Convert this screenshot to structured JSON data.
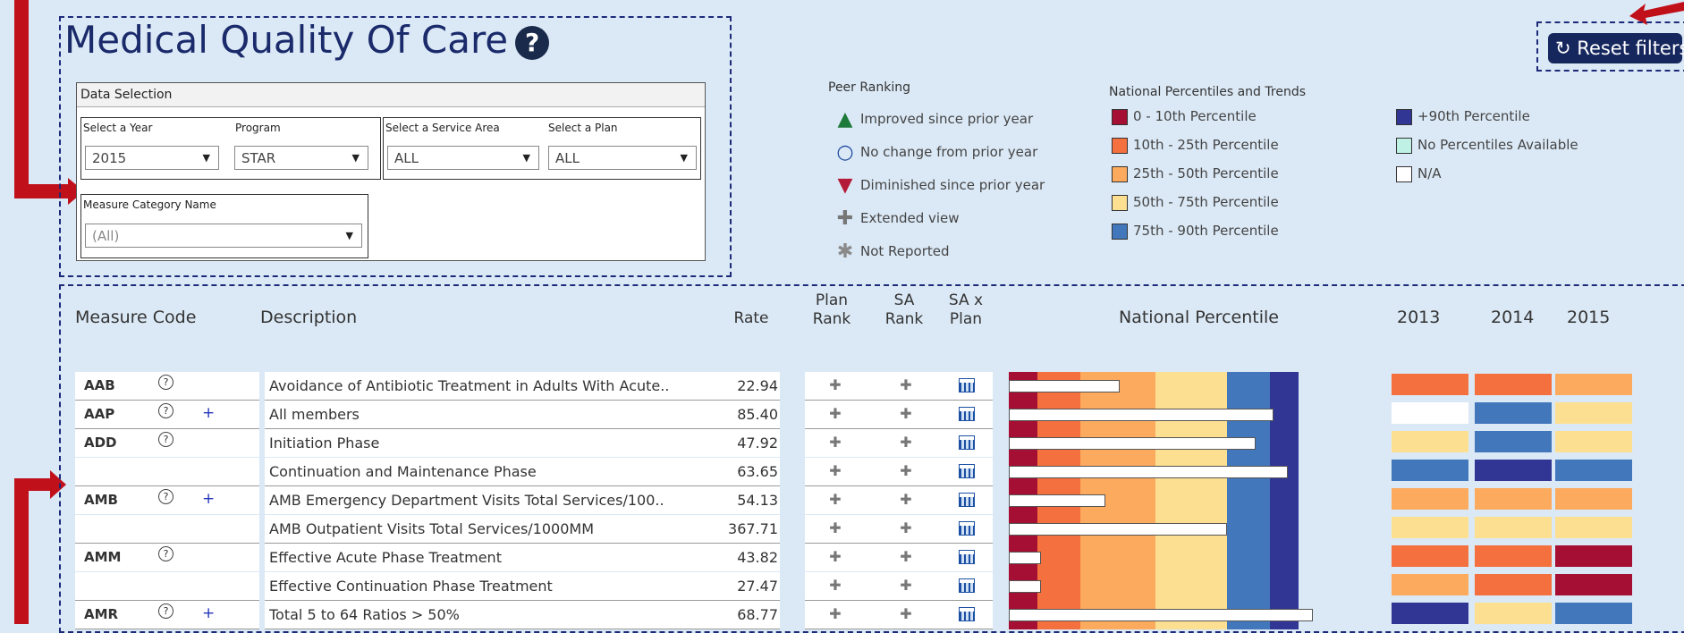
{
  "header": {
    "title": "Medical Quality Of Care",
    "help_glyph": "?",
    "reset_label": "Reset filters",
    "reset_glyph": "↻"
  },
  "data_selection": {
    "title": "Data Selection",
    "year_label": "Select a Year",
    "year_value": "2015",
    "program_label": "Program",
    "program_value": "STAR",
    "service_area_label": "Select a Service Area",
    "service_area_value": "ALL",
    "plan_label": "Select a Plan",
    "plan_value": "ALL",
    "measure_category_label": "Measure Category Name",
    "measure_category_value": "(All)",
    "dropdown_glyph": "▼"
  },
  "legend_peer": {
    "title": "Peer Ranking",
    "items": [
      {
        "glyph": "▲",
        "color": "#1e7a3a",
        "label": "Improved since prior year"
      },
      {
        "glyph": "○",
        "color": "#1f4aa0",
        "label": "No change from prior year"
      },
      {
        "glyph": "▼",
        "color": "#b31b38",
        "label": "Diminished since prior year"
      },
      {
        "glyph": "✚",
        "color": "#777777",
        "label": "Extended view"
      },
      {
        "glyph": "✱",
        "color": "#8a8a8a",
        "label": "Not Reported"
      }
    ]
  },
  "legend_percentiles": {
    "title": "National Percentiles and Trends",
    "items": [
      {
        "color": "#a50f33",
        "label": "0 - 10th Percentile"
      },
      {
        "color": "#f4703e",
        "label": "10th - 25th Percentile"
      },
      {
        "color": "#fbaa5e",
        "label": "25th - 50th Percentile"
      },
      {
        "color": "#fddf92",
        "label": "50th - 75th Percentile"
      },
      {
        "color": "#4277bb",
        "label": "75th - 90th Percentile"
      },
      {
        "color": "#313694",
        "label": "+90th Percentile"
      },
      {
        "color": "#bff1e4",
        "label": "No Percentiles Available"
      },
      {
        "color": "#ffffff",
        "label": "N/A"
      }
    ]
  },
  "table": {
    "headers": {
      "measure_code": "Measure Code",
      "description": "Description",
      "rate": "Rate",
      "plan_rank": "Plan Rank",
      "sa_rank": "SA Rank",
      "sa_x_plan": "SA x Plan",
      "national_percentile": "National Percentile",
      "years": [
        "2013",
        "2014",
        "2015"
      ]
    },
    "glyphs": {
      "help": "?",
      "expand": "+",
      "rank": "✚"
    },
    "rows": [
      {
        "code": "AAB",
        "has_help": true,
        "has_expand": false,
        "description": "Avoidance of Antibiotic Treatment in Adults With Acute..",
        "rate": "22.94",
        "percentile_bar": 0.31,
        "trend": [
          "#f4703e",
          "#f4703e",
          "#fbaa5e"
        ]
      },
      {
        "code": "AAP",
        "has_help": true,
        "has_expand": true,
        "description": "All members",
        "rate": "85.40",
        "percentile_bar": 0.74,
        "trend": [
          "#ffffff",
          "#4277bb",
          "#fddf92"
        ]
      },
      {
        "code": "ADD",
        "has_help": true,
        "has_expand": false,
        "description": "Initiation Phase",
        "rate": "47.92",
        "percentile_bar": 0.69,
        "trend": [
          "#fddf92",
          "#4277bb",
          "#fddf92"
        ]
      },
      {
        "code": "",
        "has_help": false,
        "has_expand": false,
        "description": "Continuation and Maintenance Phase",
        "rate": "63.65",
        "percentile_bar": 0.78,
        "trend": [
          "#4277bb",
          "#313694",
          "#4277bb"
        ]
      },
      {
        "code": "AMB",
        "has_help": true,
        "has_expand": true,
        "description": "AMB Emergency Department  Visits Total Services/100..",
        "rate": "54.13",
        "percentile_bar": 0.27,
        "trend": [
          "#fbaa5e",
          "#fbaa5e",
          "#fbaa5e"
        ]
      },
      {
        "code": "",
        "has_help": false,
        "has_expand": false,
        "description": "AMB Outpatient Visits Total Services/1000MM",
        "rate": "367.71",
        "percentile_bar": 0.61,
        "trend": [
          "#fddf92",
          "#fddf92",
          "#fddf92"
        ]
      },
      {
        "code": "AMM",
        "has_help": true,
        "has_expand": false,
        "description": "Effective Acute Phase Treatment",
        "rate": "43.82",
        "percentile_bar": 0.09,
        "trend": [
          "#f4703e",
          "#f4703e",
          "#a50f33"
        ]
      },
      {
        "code": "",
        "has_help": false,
        "has_expand": false,
        "description": "Effective Continuation Phase Treatment",
        "rate": "27.47",
        "percentile_bar": 0.09,
        "trend": [
          "#fbaa5e",
          "#f4703e",
          "#a50f33"
        ]
      },
      {
        "code": "AMR",
        "has_help": true,
        "has_expand": true,
        "description": "Total 5 to 64 Ratios > 50%",
        "rate": "68.77",
        "percentile_bar": 0.85,
        "trend": [
          "#313694",
          "#fddf92",
          "#4277bb"
        ]
      }
    ]
  }
}
